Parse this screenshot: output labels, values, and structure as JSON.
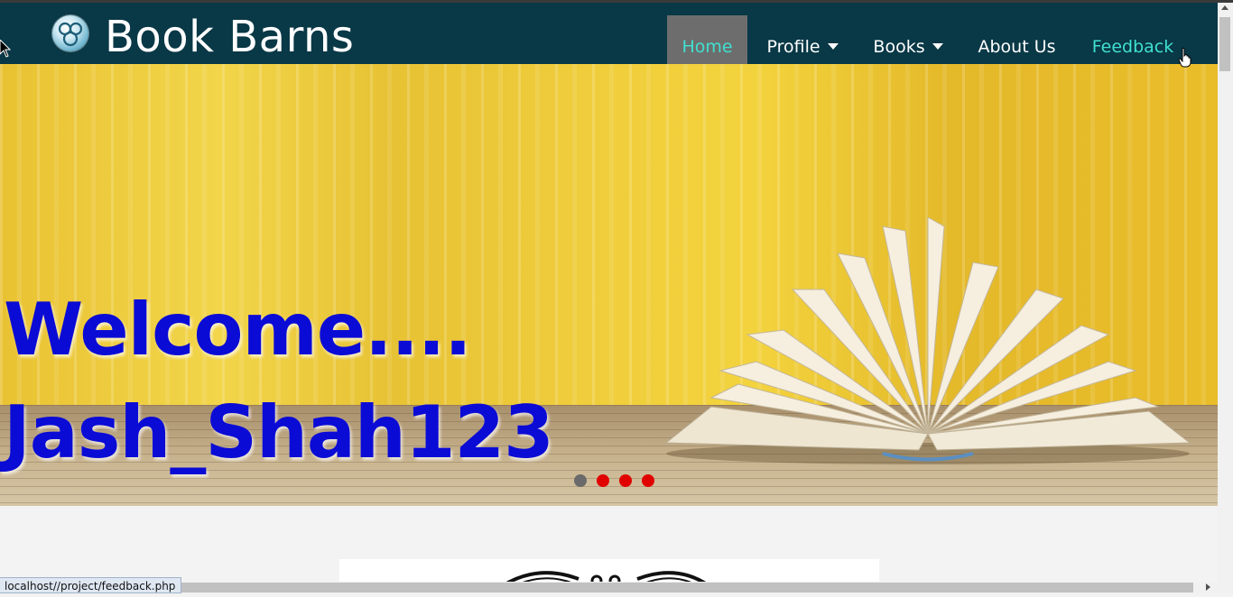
{
  "header": {
    "brand": "Book Barns",
    "logo_icon": "book-barns-logo-icon",
    "nav": [
      {
        "label": "Home",
        "active": true
      },
      {
        "label": "Profile",
        "has_dropdown": true
      },
      {
        "label": "Books",
        "has_dropdown": true
      },
      {
        "label": "About Us"
      },
      {
        "label": "Feedback",
        "hovered": true
      }
    ]
  },
  "hero": {
    "welcome": "Welcome....",
    "username": "Jash_Shah123",
    "slides": {
      "count": 4,
      "current_index": 0
    },
    "colors": {
      "heading": "#0b0bd6",
      "dot_active": "#6a6a6a",
      "dot_inactive": "#e00000"
    }
  },
  "status_bar": {
    "url": "localhost//project/feedback.php"
  },
  "theme": {
    "nav_bg": "#093846",
    "nav_active_bg": "#6d6d6d",
    "nav_highlight": "#40e0d0"
  }
}
